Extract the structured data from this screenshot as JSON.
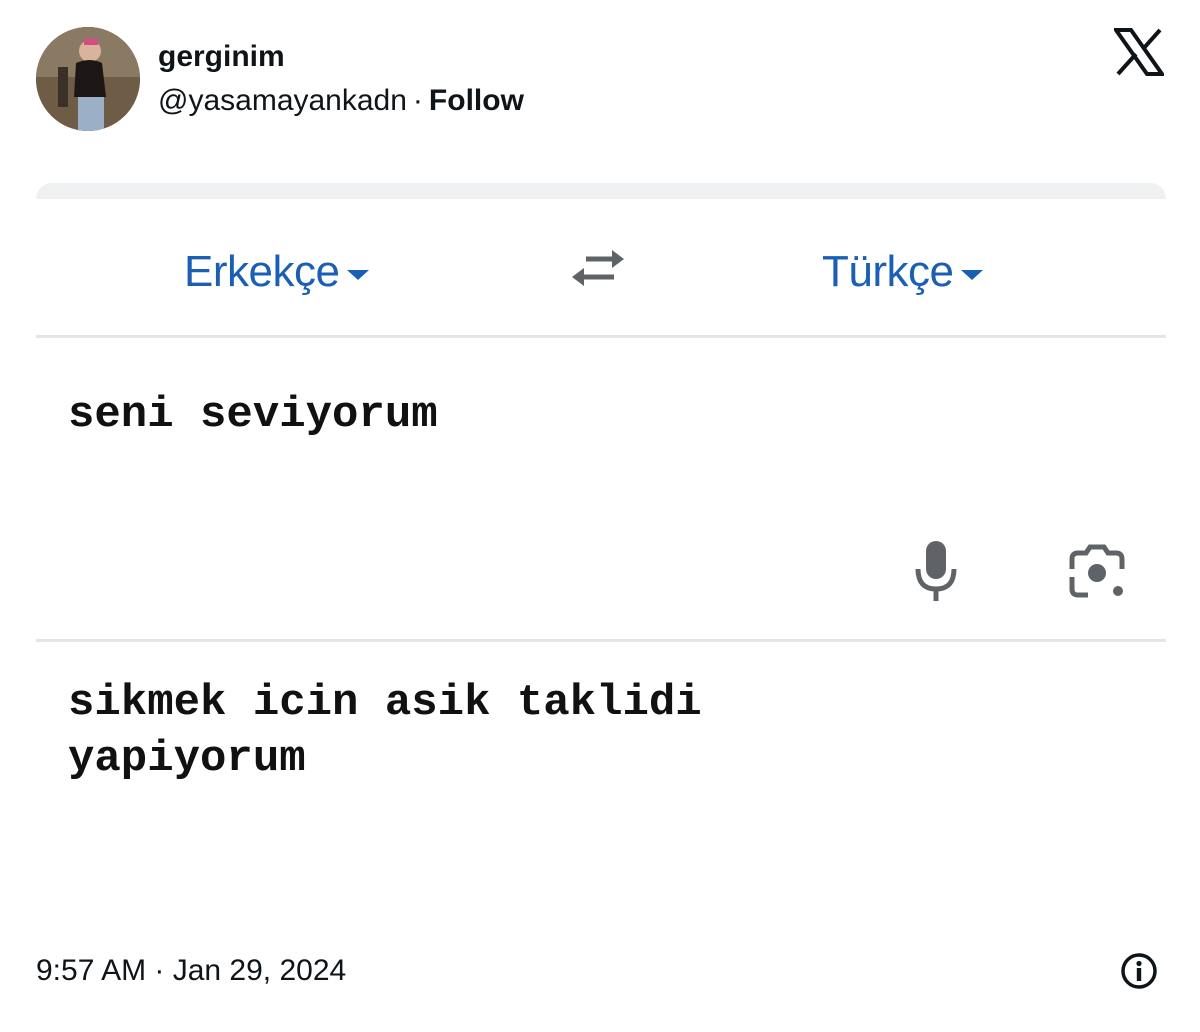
{
  "tweet": {
    "display_name": "gerginim",
    "handle": "@yasamayankadn",
    "separator": "·",
    "follow_label": "Follow",
    "timestamp": "9:57 AM · Jan 29, 2024"
  },
  "translate_screenshot": {
    "source_language": "Erkekçe",
    "target_language": "Türkçe",
    "source_text": "seni seviyorum",
    "result_text": "sikmek icin asik taklidi\nyapiyorum"
  },
  "icons": {
    "platform_logo": "x-logo-icon",
    "swap": "swap-languages-icon",
    "mic": "microphone-icon",
    "camera": "camera-icon",
    "info": "info-icon"
  },
  "colors": {
    "language_blue": "#1a5fb4",
    "icon_gray": "#5f6368",
    "text_dark": "#0f1419"
  }
}
